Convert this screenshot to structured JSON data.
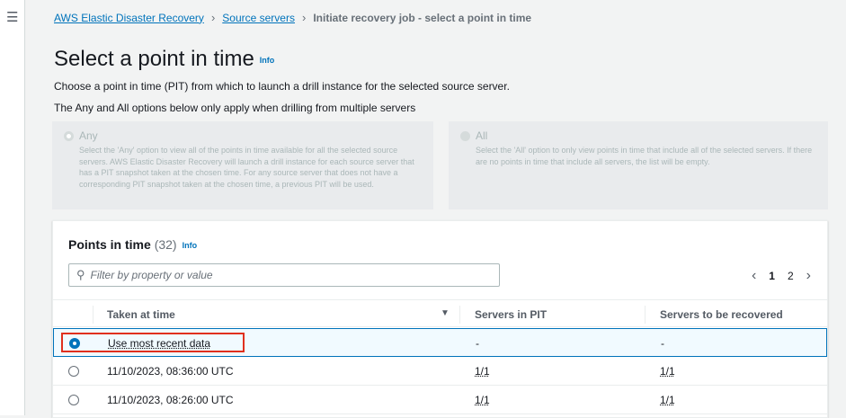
{
  "breadcrumb": {
    "items": [
      "AWS Elastic Disaster Recovery",
      "Source servers"
    ],
    "current": "Initiate recovery job - select a point in time"
  },
  "page": {
    "title": "Select a point in time",
    "info": "Info",
    "description": "Choose a point in time (PIT) from which to launch a drill instance for the selected source server.",
    "note": "The Any and All options below only apply when drilling from multiple servers"
  },
  "options": [
    {
      "label": "Any",
      "desc": "Select the 'Any' option to view all of the points in time available for all the selected source servers. AWS Elastic Disaster Recovery will launch a drill instance for each source server that has a PIT snapshot taken at the chosen time. For any source server that does not have a corresponding PIT snapshot taken at the chosen time, a previous PIT will be used."
    },
    {
      "label": "All",
      "desc": "Select the 'All' option to only view points in time that include all of the selected servers. If there are no points in time that include all servers, the list will be empty."
    }
  ],
  "table": {
    "title": "Points in time",
    "count": "(32)",
    "info": "Info",
    "filter_placeholder": "Filter by property or value",
    "pages": [
      "1",
      "2"
    ],
    "columns": [
      "Taken at time",
      "Servers in PIT",
      "Servers to be recovered"
    ],
    "rows": [
      {
        "time": "Use most recent data",
        "pit": "-",
        "rec": "-"
      },
      {
        "time": "11/10/2023, 08:36:00 UTC",
        "pit": "1/1",
        "rec": "1/1"
      },
      {
        "time": "11/10/2023, 08:26:00 UTC",
        "pit": "1/1",
        "rec": "1/1"
      }
    ]
  }
}
